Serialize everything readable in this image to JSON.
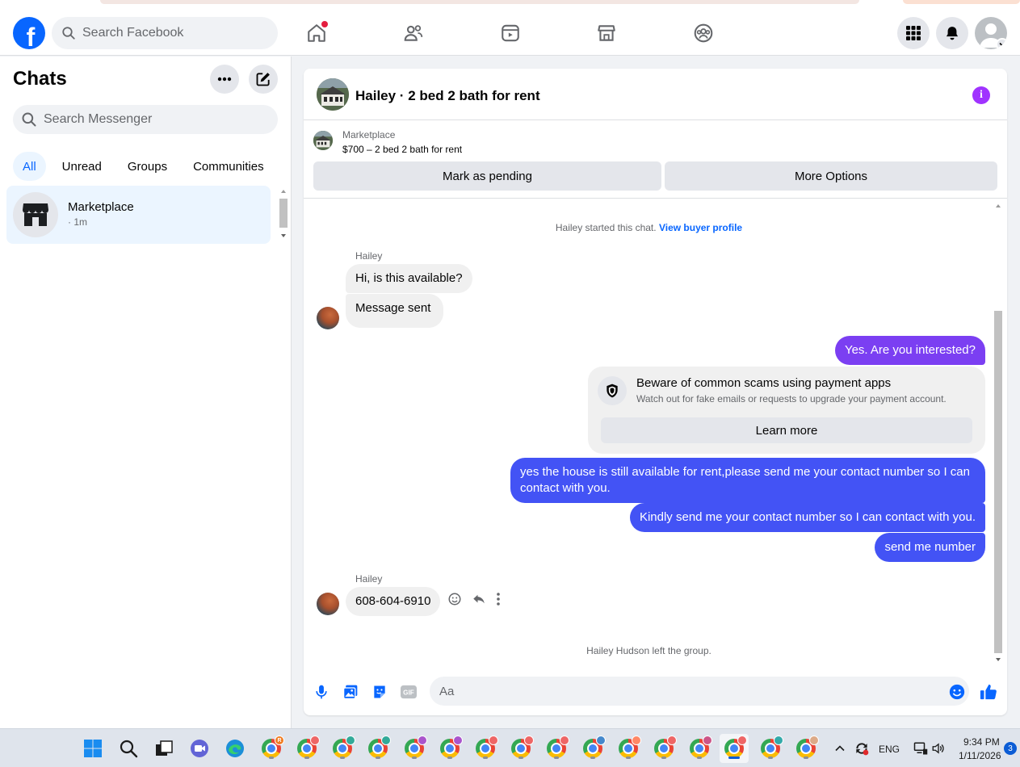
{
  "navbar": {
    "search_placeholder": "Search Facebook",
    "logo_letter": "f",
    "icons": [
      "home-icon",
      "friends-icon",
      "video-icon",
      "marketplace-icon",
      "groups-icon"
    ],
    "right_icons": [
      "menu-grid-icon",
      "bell-icon",
      "profile-avatar"
    ]
  },
  "sidebar": {
    "title": "Chats",
    "search_placeholder": "Search Messenger",
    "filters": [
      "All",
      "Unread",
      "Groups",
      "Communities"
    ],
    "active_filter": "All",
    "chats": [
      {
        "name": "Marketplace",
        "time": "· 1m"
      }
    ]
  },
  "chat": {
    "title": "Hailey · 2 bed 2 bath for rent",
    "listing": {
      "label": "Marketplace",
      "price_title": "$700 – 2 bed 2 bath for rent",
      "btn_pending": "Mark as pending",
      "btn_more": "More Options"
    },
    "system_start": "Hailey started this chat.",
    "system_start_link": "View buyer profile",
    "sender1": "Hailey",
    "msg_in_1": "Hi, is this available?",
    "msg_in_2": "Message sent",
    "msg_out_1": "Yes. Are you interested?",
    "scam": {
      "title": "Beware of common scams using payment apps",
      "subtitle": "Watch out for fake emails or requests to upgrade your payment account.",
      "button": "Learn more"
    },
    "msg_out_2": "yes the house is still available for rent,please send me your contact number so I can contact with you.",
    "msg_out_3": "Kindly send me your contact number so I can contact with you.",
    "msg_out_4": "send me number",
    "sender2": "Hailey",
    "msg_in_3": "608-604-6910",
    "system_left": "Hailey Hudson left the group.",
    "composer_placeholder": "Aa",
    "colors": {
      "out_bubble": "#4353f5",
      "out_bubble_first": "#7b3ff2",
      "accent": "#0866ff",
      "info": "#a033ff"
    }
  },
  "taskbar": {
    "lang": "ENG",
    "time": "9:34 PM",
    "date": "1/11/2026",
    "notifications": "3",
    "badge_letter": "R"
  }
}
